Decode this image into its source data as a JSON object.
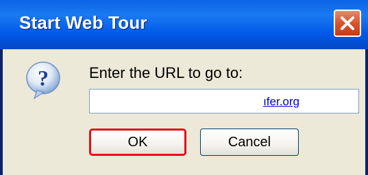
{
  "dialog": {
    "title": "Start Web Tour",
    "prompt": "Enter the URL to go to:",
    "url_input": {
      "value": "ıfer.org"
    },
    "buttons": {
      "ok_label": "OK",
      "cancel_label": "Cancel"
    },
    "icons": {
      "close": "close-icon",
      "question": "question-icon"
    },
    "colors": {
      "titlebar": "#0058e6",
      "close_button": "#d8532e",
      "ok_focus_border": "#e0101a",
      "dialog_bg": "#ece9d8"
    }
  }
}
